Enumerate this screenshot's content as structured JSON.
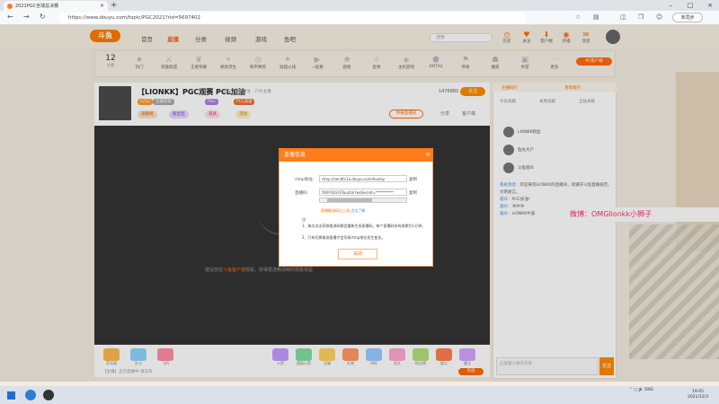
{
  "browser": {
    "tab_title": "2021PGC全球总决赛",
    "url": "https://www.douyu.com/topic/PGC2021?rid=5697402",
    "sync_label": "未同步"
  },
  "site": {
    "logo": "斗鱼",
    "nav": [
      "首页",
      "直播",
      "分类",
      "视频",
      "游戏",
      "鱼吧"
    ],
    "search_placeholder": "搜索",
    "header_icons": [
      "历史",
      "关注",
      "客户端",
      "开播",
      "消息"
    ],
    "categories": [
      "热门",
      "英雄联盟",
      "王者荣耀",
      "绝地求生",
      "和平精英",
      "穿越火线",
      "一起看",
      "颜值",
      "星秀",
      "主机游戏",
      "DOTA2",
      "传奇",
      "魔兽",
      "手游",
      "更多"
    ],
    "category_count": "12",
    "category_count_label": "分类",
    "pc_client": "PC客户端"
  },
  "room": {
    "title": "【LIONKK】PGC观赛 PCL加油",
    "sub": "举报 · 绝地求生 · 户外主播",
    "hot": "1476880",
    "follow": "关注",
    "tags": [
      "LV52",
      "主播等级",
      "PGC",
      "PCL加油"
    ],
    "pills": [
      "贡献榜",
      "粉丝团",
      "道具",
      "活动"
    ],
    "report": "举报直播间",
    "actions": [
      "分享",
      "客户端"
    ]
  },
  "video": {
    "message_prefix": "建议前往",
    "message_link": "斗鱼客户端",
    "message_suffix": "观看，获得更流畅清晰的观看体验"
  },
  "gifts": [
    "荧光棒",
    "办卡",
    "飞机",
    "火箭",
    "超级火箭",
    "宝箱",
    "礼物",
    "666",
    "鱼丸",
    "粉丝牌",
    "超火",
    "魔法"
  ],
  "gift_line": "【主播】正在直播中 请支持",
  "charge": "充值",
  "right_panel": {
    "tabs": [
      "主播排行",
      "贵宾排行"
    ],
    "subtabs": [
      "今日贡献",
      "本周贡献",
      "全站贡献"
    ],
    "ranks": [
      "LIONKK粉丝",
      "鱼丸大户",
      "斗鱼观众"
    ],
    "chat": [
      {
        "name": "系统消息：",
        "text": "欢迎来到LIONKK的直播间，请遵守斗鱼直播规范，文明发言。"
      },
      {
        "name": "观众：",
        "text": "PGC加油！"
      },
      {
        "name": "观众：",
        "text": "冲冲冲"
      },
      {
        "name": "观众：",
        "text": "LIONKK牛逼"
      }
    ],
    "input_placeholder": "这里输入聊天内容",
    "send": "发送"
  },
  "banner": "微博：OMGlionkk小狮子",
  "modal": {
    "title": "直播信息",
    "rtmp_label": "rtmp地址:",
    "rtmp_value": "rtmp://sendtc1a.douyu.com/live/ay",
    "code_label": "直播码:",
    "code_value": "5697402rSTuuzUo?wsSecret=**********",
    "copy": "复制",
    "note": "直播推流码已上线",
    "note_link": "点击了解",
    "tips_title": "注:",
    "tips": [
      "1、每次点击获取推流码都会重新生成直播码，每个直播码仅有效期为1分钟。",
      "2、只有切换推流直播才会导致rtmp地址发生变化。"
    ],
    "close_button": "关闭"
  },
  "taskbar": {
    "lang": "ENG",
    "time": "19:05",
    "date": "2021/12/3"
  }
}
